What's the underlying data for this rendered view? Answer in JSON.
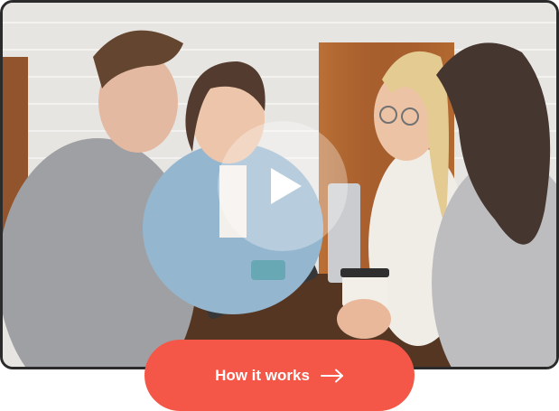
{
  "video": {
    "state": "paused",
    "play_icon": "play-icon"
  },
  "cta": {
    "label": "How it works",
    "icon": "arrow-right-icon",
    "background": "#f45747",
    "text_color": "#ffffff"
  },
  "colors": {
    "frame_border": "#2b2b2b"
  }
}
